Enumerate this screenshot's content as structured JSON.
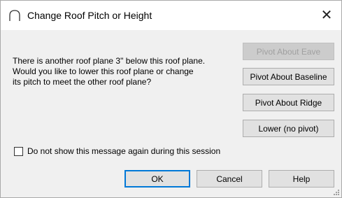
{
  "window": {
    "title": "Change Roof Pitch or Height",
    "title_icon": "roof-arc-icon",
    "close_glyph": "✕",
    "close_icon": "close-icon"
  },
  "message": "There is another roof plane 3\" below this roof plane.\nWould you like to lower this roof plane or change\nits pitch to meet the other roof plane?",
  "pivot_buttons": {
    "eave": "Pivot About Eave",
    "baseline": "Pivot About Baseline",
    "ridge": "Pivot About Ridge",
    "lower": "Lower (no pivot)"
  },
  "pivot_eave_enabled": false,
  "checkbox": {
    "label": "Do not show this message again during this session",
    "checked": false
  },
  "footer_buttons": {
    "ok": "OK",
    "cancel": "Cancel",
    "help": "Help"
  },
  "colors": {
    "dialog_background": "#f0f0f0",
    "title_background": "#ffffff",
    "default_button_border": "#0078d7",
    "disabled_text": "#a0a0a0"
  }
}
